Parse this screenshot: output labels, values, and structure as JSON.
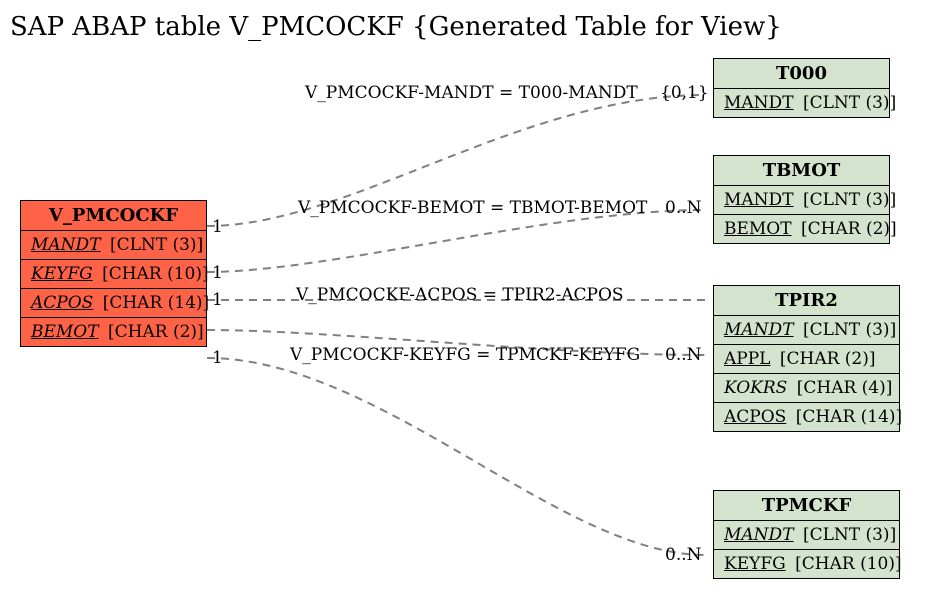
{
  "title": "SAP ABAP table V_PMCOCKF {Generated Table for View}",
  "main_table": {
    "name": "V_PMCOCKF",
    "fields": [
      {
        "name": "MANDT",
        "type": "[CLNT (3)]",
        "underline": true,
        "italic": true
      },
      {
        "name": "KEYFG",
        "type": "[CHAR (10)]",
        "underline": true,
        "italic": true
      },
      {
        "name": "ACPOS",
        "type": "[CHAR (14)]",
        "underline": true,
        "italic": true
      },
      {
        "name": "BEMOT",
        "type": "[CHAR (2)]",
        "underline": true,
        "italic": true
      }
    ]
  },
  "rel": [
    {
      "label": "V_PMCOCKF-MANDT = T000-MANDT",
      "left_card": "",
      "right_card": "{0,1}"
    },
    {
      "label": "V_PMCOCKF-BEMOT = TBMOT-BEMOT",
      "left_card": "1",
      "right_card": "0..N"
    },
    {
      "label": "V_PMCOCKF-ACPOS = TPIR2-ACPOS",
      "left_card": "1",
      "right_card": ""
    },
    {
      "label": "V_PMCOCKF-KEYFG = TPMCKF-KEYFG",
      "left_card": "1",
      "right_card": "0..N"
    }
  ],
  "extra_cards": {
    "one_top": "1",
    "bottom": "0..N"
  },
  "targets": [
    {
      "name": "T000",
      "fields": [
        {
          "name": "MANDT",
          "type": "[CLNT (3)]",
          "underline": true,
          "italic": false
        }
      ]
    },
    {
      "name": "TBMOT",
      "fields": [
        {
          "name": "MANDT",
          "type": "[CLNT (3)]",
          "underline": true,
          "italic": false
        },
        {
          "name": "BEMOT",
          "type": "[CHAR (2)]",
          "underline": true,
          "italic": false
        }
      ]
    },
    {
      "name": "TPIR2",
      "fields": [
        {
          "name": "MANDT",
          "type": "[CLNT (3)]",
          "underline": true,
          "italic": true
        },
        {
          "name": "APPL",
          "type": "[CHAR (2)]",
          "underline": true,
          "italic": false
        },
        {
          "name": "KOKRS",
          "type": "[CHAR (4)]",
          "underline": false,
          "italic": true
        },
        {
          "name": "ACPOS",
          "type": "[CHAR (14)]",
          "underline": true,
          "italic": false
        }
      ]
    },
    {
      "name": "TPMCKF",
      "fields": [
        {
          "name": "MANDT",
          "type": "[CLNT (3)]",
          "underline": true,
          "italic": true
        },
        {
          "name": "KEYFG",
          "type": "[CHAR (10)]",
          "underline": true,
          "italic": false
        }
      ]
    }
  ]
}
